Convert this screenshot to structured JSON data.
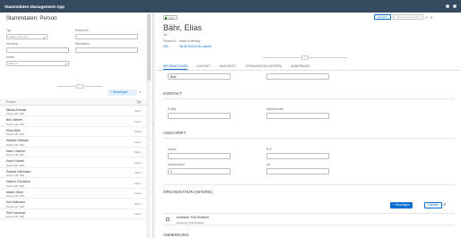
{
  "app": {
    "title": "Stammdaten Management App"
  },
  "left": {
    "title": "Stammdaten: Person",
    "filters": {
      "typ_label": "Typ",
      "typ_value": "select or fill text",
      "person_id_label": "Person ID",
      "vorname_label": "Vorname",
      "nachname_label": "Nachname",
      "verein_label": "Verein",
      "verein_value": "Bitte w..."
    },
    "add_label": "+ Hinzufügen",
    "table": {
      "col_person": "Person",
      "col_typ": "Typ",
      "rows": [
        {
          "name": "Niklas Artmeld",
          "id": "Person ID: 903",
          "type": "intern"
        },
        {
          "name": "Ben Wilbert",
          "id": "Person ID: 903",
          "type": "intern"
        },
        {
          "name": "Elias Bähr",
          "id": "Person ID: 903",
          "type": "intern"
        },
        {
          "name": "Mathes Wessau",
          "id": "Person ID: 903",
          "type": "intern"
        },
        {
          "name": "Marc Löscher",
          "id": "Person ID: 903",
          "type": "intern"
        },
        {
          "name": "Karlo Polzelt",
          "id": "Person ID: 903",
          "type": "intern"
        },
        {
          "name": "Roland Heßmann",
          "id": "Person ID: 903",
          "type": "intern"
        },
        {
          "name": "Kathrin Gloddeck",
          "id": "Person ID: 903",
          "type": "intern"
        },
        {
          "name": "Martin Stern",
          "id": "Person ID: 903",
          "type": "intern"
        },
        {
          "name": "Kai Hoffmann",
          "id": "Person ID: 903",
          "type": "intern"
        },
        {
          "name": "Rolf Kaminski",
          "id": "Person ID: 903",
          "type": "intern"
        }
      ]
    }
  },
  "object": {
    "badge": "Intern",
    "title": "Bähr, Elias",
    "subtitle": "Ok",
    "person_id_label": "Person ID",
    "person_id_value": "903",
    "last_change_label": "letzte Änderung",
    "last_change_value": "06.06.2023 8:28 Lobbrer",
    "actions": {
      "delete": "Löschen",
      "disabled": "Änderungsprotokoll"
    }
  },
  "tabs": [
    "INFORMATIONEN",
    "KONTAKT",
    "ANSCHRIFT",
    "ORGANISATION (INTERN)",
    "ANMERKUNG"
  ],
  "form": {
    "top_value": "Bähr",
    "kontakt_title": "KONTAKT",
    "email_label": "E-Mail",
    "mobile_label": "Mobilnummer",
    "anschrift_title": "ANSCHRIFT",
    "strasse_label": "Straße",
    "plz_label": "PLZ",
    "hausnummer_label": "Hausnummer",
    "hausnummer_value": "3",
    "ort_label": "Ort",
    "org_title": "ORGANISATION (INTERN)",
    "org_add": "+ Hinzufügen",
    "org_delete": "Löschen",
    "org_name": "Johannes Thal Klinikum",
    "org_sub": "Johannes Thal Klinikum",
    "anmerkung_title": "ANMERKUNG"
  }
}
